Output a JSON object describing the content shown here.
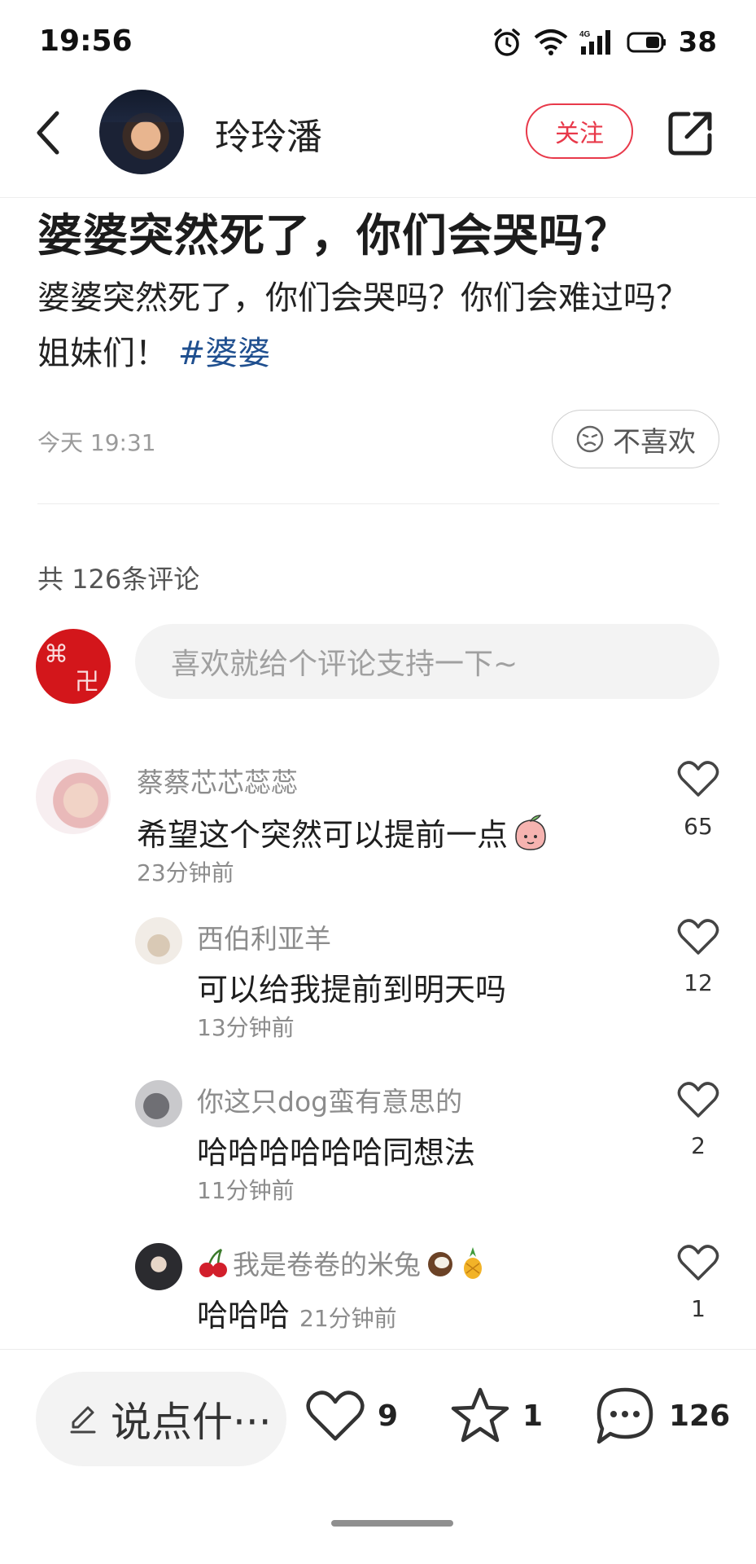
{
  "status_bar": {
    "time": "19:56",
    "battery": "38",
    "network": "4G"
  },
  "header": {
    "username": "玲玲潘",
    "follow_label": "关注"
  },
  "post": {
    "title": "婆婆突然死了，你们会哭吗？",
    "body": "婆婆突然死了，你们会哭吗？你们会难过吗？姐妹们！",
    "hashtag": "#婆婆",
    "time": "今天 19:31",
    "dislike_label": "不喜欢"
  },
  "comments_section": {
    "count_label": "共 126条评论",
    "input_placeholder": "喜欢就给个评论支持一下~"
  },
  "comments": [
    {
      "user": "蔡蔡芯芯蕊蕊",
      "text": "希望这个突然可以提前一点",
      "emoji": "peach-face",
      "time": "23分钟前",
      "likes": "65"
    },
    {
      "user": "西伯利亚羊",
      "text": "可以给我提前到明天吗",
      "time": "13分钟前",
      "likes": "12"
    },
    {
      "user": "你这只dog蛮有意思的",
      "text": "哈哈哈哈哈哈同想法",
      "time": "11分钟前",
      "likes": "2"
    },
    {
      "user": "我是卷卷的米兔",
      "text": "哈哈哈",
      "time": "21分钟前",
      "likes": "1"
    }
  ],
  "bottom_bar": {
    "comment_prompt": "说点什···",
    "likes": "9",
    "favorites": "1",
    "comments": "126"
  },
  "colors": {
    "accent_red": "#e8394a",
    "hashtag_blue": "#1f4f8f"
  }
}
